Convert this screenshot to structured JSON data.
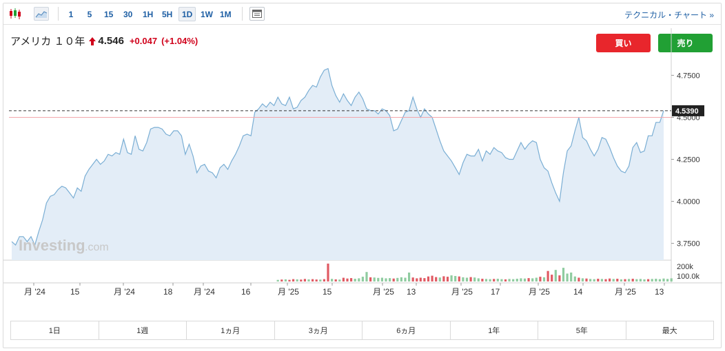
{
  "toolbar": {
    "intervals": [
      "1",
      "5",
      "15",
      "30",
      "1H",
      "5H",
      "1D",
      "1W",
      "1M"
    ],
    "active_interval": "1D",
    "technical_link": "テクニカル・チャート »"
  },
  "instrument": {
    "name": "アメリカ １０年",
    "price": "4.546",
    "change": "+0.047",
    "change_pct": "(+1.04%)"
  },
  "actions": {
    "buy_label": "買い",
    "sell_label": "売り"
  },
  "watermark": {
    "main": "Investing",
    "suffix": ".com"
  },
  "ranges": [
    "1日",
    "1週",
    "1ヵ月",
    "3ヵ月",
    "6ヵ月",
    "1年",
    "5年",
    "最大"
  ],
  "colors": {
    "accent": "#1e5fa4",
    "line": "#7aaed4",
    "area": "#e3edf7",
    "down": "#e05a63",
    "up": "#8fcca0",
    "buy": "#e8262c",
    "sell": "#21a034"
  },
  "chart_data": {
    "type": "area",
    "ylim": [
      3.65,
      4.85
    ],
    "yticks": [
      3.75,
      4.0,
      4.25,
      4.5,
      4.75
    ],
    "ytick_labels": [
      "3.7500",
      "4.0000",
      "4.2500",
      "4.5000",
      "4.7500"
    ],
    "current_value": 4.539,
    "current_label": "4.5390",
    "reference_value": 4.5,
    "x_tick_labels": [
      "月 '24",
      "15",
      "月 '24",
      "18",
      "月 '24",
      "16",
      "月 '25",
      "15",
      "月 '25",
      "13",
      "月 '25",
      "17",
      "月 '25",
      "14",
      "月 '25",
      "13"
    ],
    "y": [
      3.76,
      3.74,
      3.79,
      3.79,
      3.76,
      3.79,
      3.74,
      3.82,
      3.89,
      3.99,
      4.03,
      4.04,
      4.07,
      4.09,
      4.08,
      4.05,
      4.02,
      4.08,
      4.06,
      4.15,
      4.19,
      4.22,
      4.25,
      4.22,
      4.24,
      4.28,
      4.27,
      4.29,
      4.28,
      4.37,
      4.29,
      4.28,
      4.39,
      4.31,
      4.3,
      4.35,
      4.43,
      4.44,
      4.44,
      4.43,
      4.4,
      4.39,
      4.42,
      4.42,
      4.39,
      4.28,
      4.34,
      4.27,
      4.17,
      4.21,
      4.22,
      4.18,
      4.17,
      4.14,
      4.2,
      4.22,
      4.19,
      4.24,
      4.28,
      4.33,
      4.39,
      4.4,
      4.39,
      4.53,
      4.55,
      4.58,
      4.56,
      4.59,
      4.57,
      4.62,
      4.58,
      4.57,
      4.62,
      4.55,
      4.56,
      4.6,
      4.62,
      4.66,
      4.69,
      4.68,
      4.74,
      4.78,
      4.79,
      4.69,
      4.63,
      4.59,
      4.64,
      4.6,
      4.57,
      4.62,
      4.65,
      4.61,
      4.55,
      4.54,
      4.54,
      4.52,
      4.55,
      4.54,
      4.51,
      4.42,
      4.43,
      4.48,
      4.53,
      4.54,
      4.62,
      4.55,
      4.5,
      4.55,
      4.52,
      4.5,
      4.43,
      4.36,
      4.3,
      4.27,
      4.24,
      4.2,
      4.16,
      4.23,
      4.28,
      4.27,
      4.27,
      4.31,
      4.24,
      4.3,
      4.28,
      4.32,
      4.3,
      4.29,
      4.26,
      4.25,
      4.25,
      4.3,
      4.35,
      4.31,
      4.34,
      4.36,
      4.35,
      4.25,
      4.2,
      4.18,
      4.11,
      4.05,
      4.0,
      4.17,
      4.3,
      4.33,
      4.42,
      4.5,
      4.38,
      4.36,
      4.31,
      4.27,
      4.31,
      4.38,
      4.37,
      4.32,
      4.26,
      4.21,
      4.18,
      4.17,
      4.21,
      4.32,
      4.35,
      4.29,
      4.3,
      4.39,
      4.39,
      4.47,
      4.47,
      4.54
    ],
    "volume": [
      {
        "i": 69,
        "v": 15,
        "d": "up"
      },
      {
        "i": 70,
        "v": 18,
        "d": "down"
      },
      {
        "i": 71,
        "v": 20,
        "d": "up"
      },
      {
        "i": 72,
        "v": 16,
        "d": "down"
      },
      {
        "i": 73,
        "v": 22,
        "d": "down"
      },
      {
        "i": 74,
        "v": 20,
        "d": "up"
      },
      {
        "i": 75,
        "v": 18,
        "d": "down"
      },
      {
        "i": 76,
        "v": 24,
        "d": "down"
      },
      {
        "i": 77,
        "v": 20,
        "d": "up"
      },
      {
        "i": 78,
        "v": 22,
        "d": "down"
      },
      {
        "i": 79,
        "v": 19,
        "d": "down"
      },
      {
        "i": 80,
        "v": 18,
        "d": "up"
      },
      {
        "i": 81,
        "v": 22,
        "d": "down"
      },
      {
        "i": 82,
        "v": 170,
        "d": "down"
      },
      {
        "i": 83,
        "v": 25,
        "d": "up"
      },
      {
        "i": 84,
        "v": 20,
        "d": "down"
      },
      {
        "i": 85,
        "v": 18,
        "d": "up"
      },
      {
        "i": 86,
        "v": 35,
        "d": "down"
      },
      {
        "i": 87,
        "v": 28,
        "d": "down"
      },
      {
        "i": 88,
        "v": 32,
        "d": "down"
      },
      {
        "i": 89,
        "v": 26,
        "d": "up"
      },
      {
        "i": 90,
        "v": 30,
        "d": "up"
      },
      {
        "i": 91,
        "v": 45,
        "d": "up"
      },
      {
        "i": 92,
        "v": 90,
        "d": "up"
      },
      {
        "i": 93,
        "v": 40,
        "d": "down"
      },
      {
        "i": 94,
        "v": 38,
        "d": "up"
      },
      {
        "i": 95,
        "v": 34,
        "d": "up"
      },
      {
        "i": 96,
        "v": 36,
        "d": "up"
      },
      {
        "i": 97,
        "v": 30,
        "d": "up"
      },
      {
        "i": 98,
        "v": 32,
        "d": "up"
      },
      {
        "i": 99,
        "v": 28,
        "d": "down"
      },
      {
        "i": 100,
        "v": 34,
        "d": "up"
      },
      {
        "i": 101,
        "v": 40,
        "d": "up"
      },
      {
        "i": 102,
        "v": 36,
        "d": "up"
      },
      {
        "i": 103,
        "v": 85,
        "d": "up"
      },
      {
        "i": 104,
        "v": 38,
        "d": "down"
      },
      {
        "i": 105,
        "v": 30,
        "d": "down"
      },
      {
        "i": 106,
        "v": 36,
        "d": "down"
      },
      {
        "i": 107,
        "v": 32,
        "d": "down"
      },
      {
        "i": 108,
        "v": 48,
        "d": "down"
      },
      {
        "i": 109,
        "v": 55,
        "d": "down"
      },
      {
        "i": 110,
        "v": 42,
        "d": "down"
      },
      {
        "i": 111,
        "v": 38,
        "d": "up"
      },
      {
        "i": 112,
        "v": 50,
        "d": "down"
      },
      {
        "i": 113,
        "v": 45,
        "d": "down"
      },
      {
        "i": 114,
        "v": 58,
        "d": "up"
      },
      {
        "i": 115,
        "v": 52,
        "d": "up"
      },
      {
        "i": 116,
        "v": 48,
        "d": "down"
      },
      {
        "i": 117,
        "v": 40,
        "d": "up"
      },
      {
        "i": 118,
        "v": 36,
        "d": "up"
      },
      {
        "i": 119,
        "v": 42,
        "d": "down"
      },
      {
        "i": 120,
        "v": 38,
        "d": "up"
      },
      {
        "i": 121,
        "v": 30,
        "d": "up"
      },
      {
        "i": 122,
        "v": 26,
        "d": "down"
      },
      {
        "i": 123,
        "v": 24,
        "d": "up"
      },
      {
        "i": 124,
        "v": 22,
        "d": "up"
      },
      {
        "i": 125,
        "v": 24,
        "d": "down"
      },
      {
        "i": 126,
        "v": 26,
        "d": "up"
      },
      {
        "i": 127,
        "v": 22,
        "d": "up"
      },
      {
        "i": 128,
        "v": 20,
        "d": "down"
      },
      {
        "i": 129,
        "v": 24,
        "d": "up"
      },
      {
        "i": 130,
        "v": 22,
        "d": "up"
      },
      {
        "i": 131,
        "v": 26,
        "d": "up"
      },
      {
        "i": 132,
        "v": 30,
        "d": "up"
      },
      {
        "i": 133,
        "v": 28,
        "d": "up"
      },
      {
        "i": 134,
        "v": 32,
        "d": "down"
      },
      {
        "i": 135,
        "v": 30,
        "d": "up"
      },
      {
        "i": 136,
        "v": 36,
        "d": "up"
      },
      {
        "i": 137,
        "v": 45,
        "d": "down"
      },
      {
        "i": 138,
        "v": 40,
        "d": "up"
      },
      {
        "i": 139,
        "v": 100,
        "d": "down"
      },
      {
        "i": 140,
        "v": 65,
        "d": "down"
      },
      {
        "i": 141,
        "v": 110,
        "d": "up"
      },
      {
        "i": 142,
        "v": 58,
        "d": "down"
      },
      {
        "i": 143,
        "v": 130,
        "d": "up"
      },
      {
        "i": 144,
        "v": 75,
        "d": "up"
      },
      {
        "i": 145,
        "v": 85,
        "d": "up"
      },
      {
        "i": 146,
        "v": 48,
        "d": "up"
      },
      {
        "i": 147,
        "v": 36,
        "d": "down"
      },
      {
        "i": 148,
        "v": 30,
        "d": "up"
      },
      {
        "i": 149,
        "v": 28,
        "d": "down"
      },
      {
        "i": 150,
        "v": 24,
        "d": "up"
      },
      {
        "i": 151,
        "v": 22,
        "d": "up"
      },
      {
        "i": 152,
        "v": 26,
        "d": "down"
      },
      {
        "i": 153,
        "v": 24,
        "d": "up"
      },
      {
        "i": 154,
        "v": 22,
        "d": "down"
      },
      {
        "i": 155,
        "v": 28,
        "d": "down"
      },
      {
        "i": 156,
        "v": 24,
        "d": "up"
      },
      {
        "i": 157,
        "v": 26,
        "d": "down"
      },
      {
        "i": 158,
        "v": 20,
        "d": "up"
      },
      {
        "i": 159,
        "v": 22,
        "d": "down"
      },
      {
        "i": 160,
        "v": 24,
        "d": "up"
      },
      {
        "i": 161,
        "v": 26,
        "d": "down"
      },
      {
        "i": 162,
        "v": 22,
        "d": "up"
      },
      {
        "i": 163,
        "v": 24,
        "d": "up"
      },
      {
        "i": 164,
        "v": 20,
        "d": "up"
      },
      {
        "i": 165,
        "v": 22,
        "d": "down"
      },
      {
        "i": 166,
        "v": 24,
        "d": "up"
      },
      {
        "i": 167,
        "v": 26,
        "d": "up"
      },
      {
        "i": 168,
        "v": 22,
        "d": "up"
      },
      {
        "i": 169,
        "v": 28,
        "d": "up"
      },
      {
        "i": 170,
        "v": 24,
        "d": "up"
      },
      {
        "i": 171,
        "v": 30,
        "d": "up"
      }
    ],
    "volume_axis_labels": [
      "200k",
      "100.0k"
    ]
  }
}
